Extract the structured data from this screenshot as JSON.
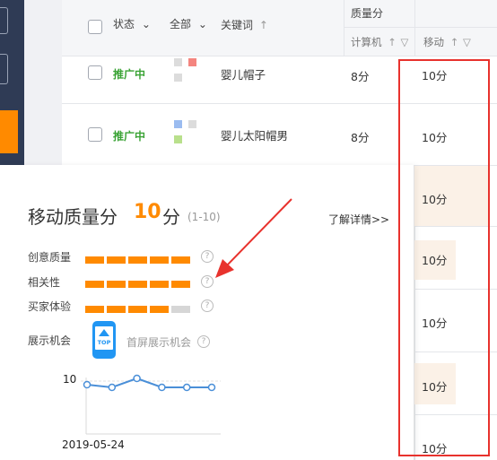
{
  "header": {
    "status_label": "状态",
    "all_label": "全部",
    "keyword_label": "关键词",
    "quality_group_label": "质量分",
    "computer_label": "计算机",
    "mobile_label": "移动"
  },
  "rows": [
    {
      "status": "推广中",
      "keyword": "婴儿帽子",
      "computer_score": "8分",
      "mobile_score": "10分"
    },
    {
      "status": "推广中",
      "keyword": "婴儿太阳帽男",
      "computer_score": "8分",
      "mobile_score": "10分"
    }
  ],
  "mobile_column_extra": [
    "10分",
    "10分",
    "10分",
    "10分",
    "10分"
  ],
  "popup": {
    "title": "移动质量分",
    "score": "10",
    "unit": "分",
    "range": "(1-10)",
    "detail_link": "了解详情>>",
    "metrics": [
      {
        "label": "创意质量",
        "filled": 5,
        "total": 5
      },
      {
        "label": "相关性",
        "filled": 5,
        "total": 5
      },
      {
        "label": "买家体验",
        "filled": 4,
        "total": 5
      }
    ],
    "display_label": "展示机会",
    "phone_badge": "TOP",
    "first_screen_label": "首屏展示机会",
    "help_glyph": "?"
  },
  "colors": {
    "accent": "#ff8a00",
    "bar_empty": "#d6d6d6",
    "status_green": "#3aa335",
    "highlight_red": "#e8322d",
    "line_blue": "#4a8fd8"
  },
  "chart_data": {
    "type": "line",
    "y_tick_label": "10",
    "x_label": "2019-05-24",
    "series": [
      {
        "values": [
          10,
          10,
          10,
          10,
          10,
          10
        ]
      }
    ]
  }
}
